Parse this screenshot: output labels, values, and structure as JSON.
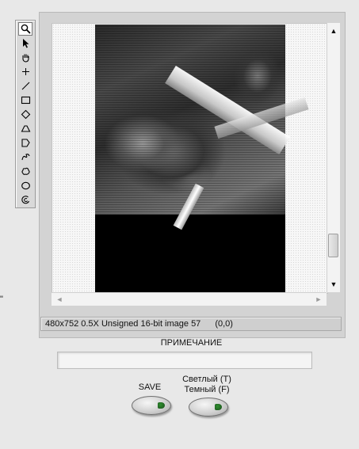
{
  "left_cut_text": "\"",
  "palette": {
    "tools": [
      {
        "name": "zoom-tool",
        "icon": "magnifier-icon",
        "selected": true
      },
      {
        "name": "pointer-tool",
        "icon": "arrow-pointer-icon"
      },
      {
        "name": "pan-tool",
        "icon": "hand-icon"
      },
      {
        "name": "point-tool",
        "icon": "crosshair-icon"
      },
      {
        "name": "line-tool",
        "icon": "line-icon"
      },
      {
        "name": "rectangle-tool",
        "icon": "rectangle-icon"
      },
      {
        "name": "rotated-rectangle-tool",
        "icon": "diamond-icon"
      },
      {
        "name": "annulus-tool",
        "icon": "annulus-icon"
      },
      {
        "name": "polygon-tool",
        "icon": "polygon-icon"
      },
      {
        "name": "freehand-line-tool",
        "icon": "freehand-icon"
      },
      {
        "name": "freehand-region-tool",
        "icon": "cloud-icon"
      },
      {
        "name": "oval-tool",
        "icon": "oval-icon"
      },
      {
        "name": "broken-annulus-tool",
        "icon": "broken-annulus-icon"
      }
    ]
  },
  "scroll": {
    "up": "▲",
    "down": "▼",
    "left": "◄",
    "right": "►",
    "vertical_position_fraction": 0.9
  },
  "status": {
    "info": "480x752 0.5X Unsigned 16-bit image 57",
    "coords": "(0,0)"
  },
  "note": {
    "label": "ПРИМЕЧАНИЕ",
    "value": ""
  },
  "buttons": {
    "save_label": "SAVE",
    "light_label_line1": "Светлый (T)",
    "light_label_line2": "Темный (F)",
    "led_color": "#2f8f2f"
  }
}
